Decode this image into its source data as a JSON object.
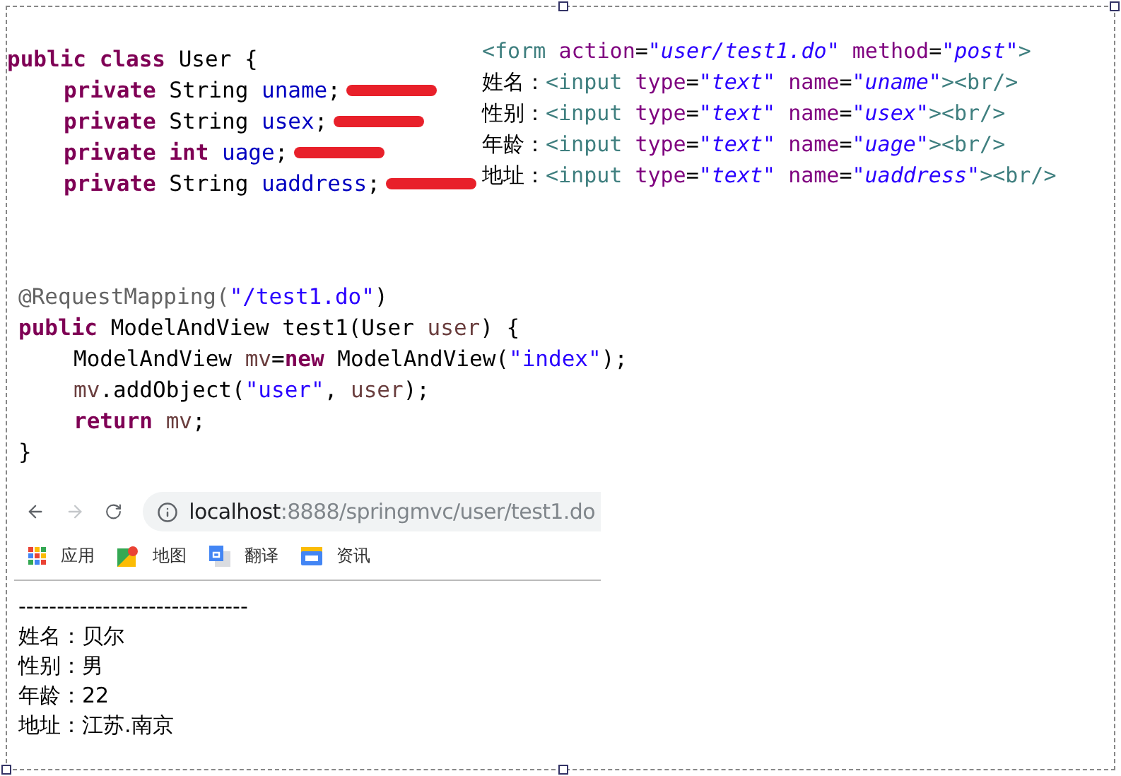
{
  "java_class": {
    "lines": [
      {
        "indented": false,
        "redacted": false,
        "tokens": [
          {
            "t": "public ",
            "kind": "keyword"
          },
          {
            "t": "class ",
            "kind": "keyword"
          },
          {
            "t": "User {",
            "kind": "plain"
          }
        ]
      },
      {
        "indented": true,
        "redacted": true,
        "tokens": [
          {
            "t": "private ",
            "kind": "keyword"
          },
          {
            "t": "String ",
            "kind": "plain"
          },
          {
            "t": "uname",
            "kind": "field"
          },
          {
            "t": ";",
            "kind": "plain"
          }
        ]
      },
      {
        "indented": true,
        "redacted": true,
        "tokens": [
          {
            "t": "private ",
            "kind": "keyword"
          },
          {
            "t": "String ",
            "kind": "plain"
          },
          {
            "t": "usex",
            "kind": "field"
          },
          {
            "t": ";",
            "kind": "plain"
          }
        ]
      },
      {
        "indented": true,
        "redacted": true,
        "tokens": [
          {
            "t": "private ",
            "kind": "keyword"
          },
          {
            "t": "int ",
            "kind": "keyword"
          },
          {
            "t": "uage",
            "kind": "field"
          },
          {
            "t": ";",
            "kind": "plain"
          }
        ]
      },
      {
        "indented": true,
        "redacted": true,
        "tokens": [
          {
            "t": "private ",
            "kind": "keyword"
          },
          {
            "t": "String ",
            "kind": "plain"
          },
          {
            "t": "uaddress",
            "kind": "field"
          },
          {
            "t": ";",
            "kind": "plain"
          }
        ]
      }
    ]
  },
  "jsp_form": {
    "lines": [
      {
        "tokens": [
          {
            "t": "<form ",
            "kind": "tag"
          },
          {
            "t": "action",
            "kind": "attr"
          },
          {
            "t": "=",
            "kind": "plain"
          },
          {
            "t": "\"user/test1.do\"",
            "kind": "value"
          },
          {
            "t": " method",
            "kind": "attr"
          },
          {
            "t": "=",
            "kind": "plain"
          },
          {
            "t": "\"post\"",
            "kind": "value"
          },
          {
            "t": ">",
            "kind": "tag"
          }
        ]
      },
      {
        "tokens": [
          {
            "t": "姓名：",
            "kind": "text"
          },
          {
            "t": "<input ",
            "kind": "tag"
          },
          {
            "t": "type",
            "kind": "attr"
          },
          {
            "t": "=",
            "kind": "plain"
          },
          {
            "t": "\"text\"",
            "kind": "value"
          },
          {
            "t": " name",
            "kind": "attr"
          },
          {
            "t": "=",
            "kind": "plain"
          },
          {
            "t": "\"uname\"",
            "kind": "value"
          },
          {
            "t": "><br/>",
            "kind": "tag"
          }
        ]
      },
      {
        "tokens": [
          {
            "t": "性别：",
            "kind": "text"
          },
          {
            "t": "<input ",
            "kind": "tag"
          },
          {
            "t": "type",
            "kind": "attr"
          },
          {
            "t": "=",
            "kind": "plain"
          },
          {
            "t": "\"text\"",
            "kind": "value"
          },
          {
            "t": " name",
            "kind": "attr"
          },
          {
            "t": "=",
            "kind": "plain"
          },
          {
            "t": "\"usex\"",
            "kind": "value"
          },
          {
            "t": "><br/>",
            "kind": "tag"
          }
        ]
      },
      {
        "tokens": [
          {
            "t": "年龄：",
            "kind": "text"
          },
          {
            "t": "<input ",
            "kind": "tag"
          },
          {
            "t": "type",
            "kind": "attr"
          },
          {
            "t": "=",
            "kind": "plain"
          },
          {
            "t": "\"text\"",
            "kind": "value"
          },
          {
            "t": " name",
            "kind": "attr"
          },
          {
            "t": "=",
            "kind": "plain"
          },
          {
            "t": "\"uage\"",
            "kind": "value"
          },
          {
            "t": "><br/>",
            "kind": "tag"
          }
        ]
      },
      {
        "tokens": [
          {
            "t": "地址：",
            "kind": "text"
          },
          {
            "t": "<input ",
            "kind": "tag"
          },
          {
            "t": "type",
            "kind": "attr"
          },
          {
            "t": "=",
            "kind": "plain"
          },
          {
            "t": "\"text\"",
            "kind": "value"
          },
          {
            "t": " name",
            "kind": "attr"
          },
          {
            "t": "=",
            "kind": "plain"
          },
          {
            "t": "\"uaddress\"",
            "kind": "value"
          },
          {
            "t": "><br/>",
            "kind": "tag"
          }
        ]
      }
    ]
  },
  "controller_method": {
    "lines": [
      {
        "indented": false,
        "tokens": [
          {
            "t": "@RequestMapping(",
            "kind": "annotation"
          },
          {
            "t": "\"/test1.do\"",
            "kind": "string"
          },
          {
            "t": ")",
            "kind": "plain"
          }
        ]
      },
      {
        "indented": false,
        "tokens": [
          {
            "t": "public ",
            "kind": "keyword"
          },
          {
            "t": "ModelAndView test1(User ",
            "kind": "plain"
          },
          {
            "t": "user",
            "kind": "local"
          },
          {
            "t": ") {",
            "kind": "plain"
          }
        ]
      },
      {
        "indented": true,
        "tokens": [
          {
            "t": "ModelAndView ",
            "kind": "plain"
          },
          {
            "t": "mv",
            "kind": "local"
          },
          {
            "t": "=",
            "kind": "plain"
          },
          {
            "t": "new ",
            "kind": "keyword"
          },
          {
            "t": "ModelAndView(",
            "kind": "plain"
          },
          {
            "t": "\"index\"",
            "kind": "string"
          },
          {
            "t": ");",
            "kind": "plain"
          }
        ]
      },
      {
        "indented": true,
        "tokens": [
          {
            "t": "mv",
            "kind": "local"
          },
          {
            "t": ".addObject(",
            "kind": "plain"
          },
          {
            "t": "\"user\"",
            "kind": "string"
          },
          {
            "t": ", ",
            "kind": "plain"
          },
          {
            "t": "user",
            "kind": "local"
          },
          {
            "t": ");",
            "kind": "plain"
          }
        ]
      },
      {
        "indented": true,
        "tokens": [
          {
            "t": "return ",
            "kind": "keyword"
          },
          {
            "t": "mv",
            "kind": "local"
          },
          {
            "t": ";",
            "kind": "plain"
          }
        ]
      },
      {
        "indented": false,
        "tokens": [
          {
            "t": "}",
            "kind": "plain"
          }
        ]
      }
    ]
  },
  "browser": {
    "forward_disabled": true,
    "url": {
      "host": "localhost",
      "rest": ":8888/springmvc/user/test1.do"
    },
    "bookmarks": [
      {
        "label": "应用",
        "kind": "apps"
      },
      {
        "label": "地图",
        "kind": "maps"
      },
      {
        "label": "翻译",
        "kind": "translate"
      },
      {
        "label": "资讯",
        "kind": "news"
      }
    ],
    "separator": "------------------------------",
    "output_lines": [
      "姓名：贝尔",
      "性别：男",
      "年龄：22",
      "地址：江苏.南京"
    ]
  }
}
